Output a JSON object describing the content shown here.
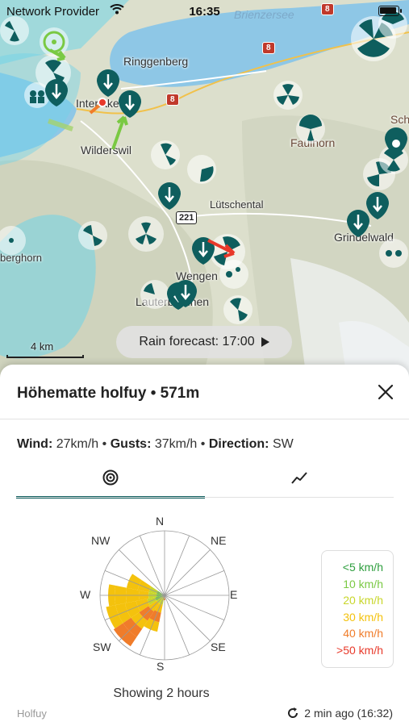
{
  "status_bar": {
    "carrier": "Network Provider",
    "time": "16:35"
  },
  "map": {
    "labels": {
      "brienzersee": "Brienzersee",
      "ringgenberg": "Ringgenberg",
      "interlaken": "Interlaken",
      "wilderswil": "Wilderswil",
      "faulhorn": "Faulhorn",
      "lutschental": "Lütschental",
      "grindelwald": "Grindelwald",
      "wengen": "Wengen",
      "lauterbrunnen": "Lauterbrunnen",
      "burghorn": "berghorn",
      "sch": "Sch"
    },
    "road_8a": "8",
    "road_8b": "8",
    "road_8c": "8",
    "road_221": "221",
    "scale_label": "4 km",
    "rain_forecast_button": "Rain forecast: 17:00"
  },
  "station": {
    "title": "Höhematte holfuy • 571m",
    "wind_label": "Wind:",
    "wind_value": "27km/h",
    "gusts_label": "Gusts:",
    "gusts_value": "37km/h",
    "direction_label": "Direction:",
    "direction_value": "SW",
    "separator": "•"
  },
  "tabs": {
    "active": "wind-rose",
    "items": [
      "wind-rose",
      "chart"
    ]
  },
  "wind_rose": {
    "directions": [
      "N",
      "NE",
      "E",
      "SE",
      "S",
      "SW",
      "W",
      "NW"
    ],
    "legend": [
      {
        "label": "<5 km/h",
        "color": "#2e9e3e"
      },
      {
        "label": "10 km/h",
        "color": "#7ac943"
      },
      {
        "label": "20 km/h",
        "color": "#c8d62a"
      },
      {
        "label": "30 km/h",
        "color": "#f4c20d"
      },
      {
        "label": "40 km/h",
        "color": "#f07c2a"
      },
      {
        "label": ">50 km/h",
        "color": "#e8392a"
      }
    ],
    "showing": "Showing 2 hours"
  },
  "footer": {
    "source": "Holfuy",
    "updated": "2 min ago (16:32)"
  },
  "colors": {
    "accent": "#0e5e5e",
    "lake": "#8ec7e6",
    "rain": "#6fd3e8"
  }
}
